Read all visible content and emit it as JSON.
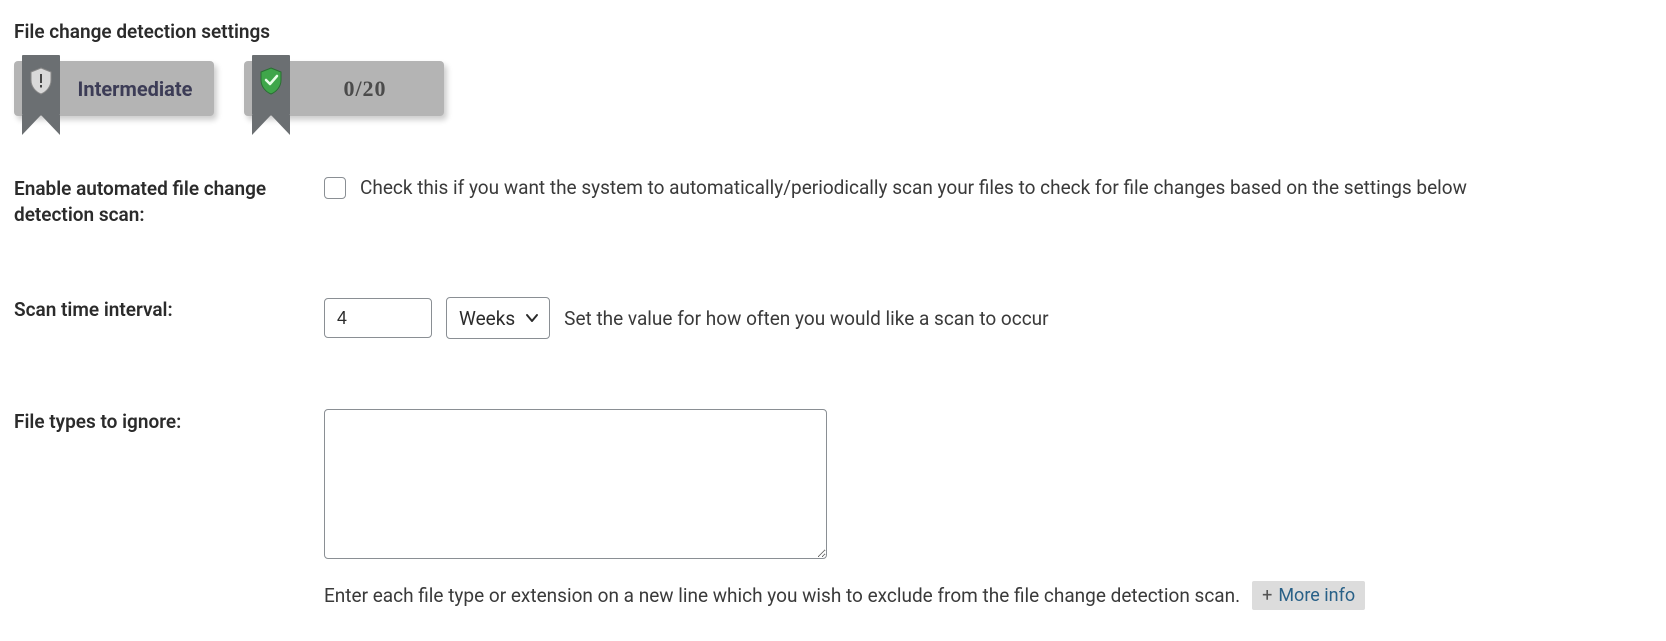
{
  "heading": "File change detection settings",
  "badges": {
    "level": "Intermediate",
    "progress": "0/20"
  },
  "rows": {
    "enable": {
      "label": "Enable automated file change detection scan:",
      "desc": "Check this if you want the system to automatically/periodically scan your files to check for file changes based on the settings below"
    },
    "interval": {
      "label": "Scan time interval:",
      "value": "4",
      "unit": "Weeks",
      "desc": "Set the value for how often you would like a scan to occur"
    },
    "ignore": {
      "label": "File types to ignore:",
      "value": "",
      "note": "Enter each file type or extension on a new line which you wish to exclude from the file change detection scan.",
      "more": "More info"
    }
  }
}
